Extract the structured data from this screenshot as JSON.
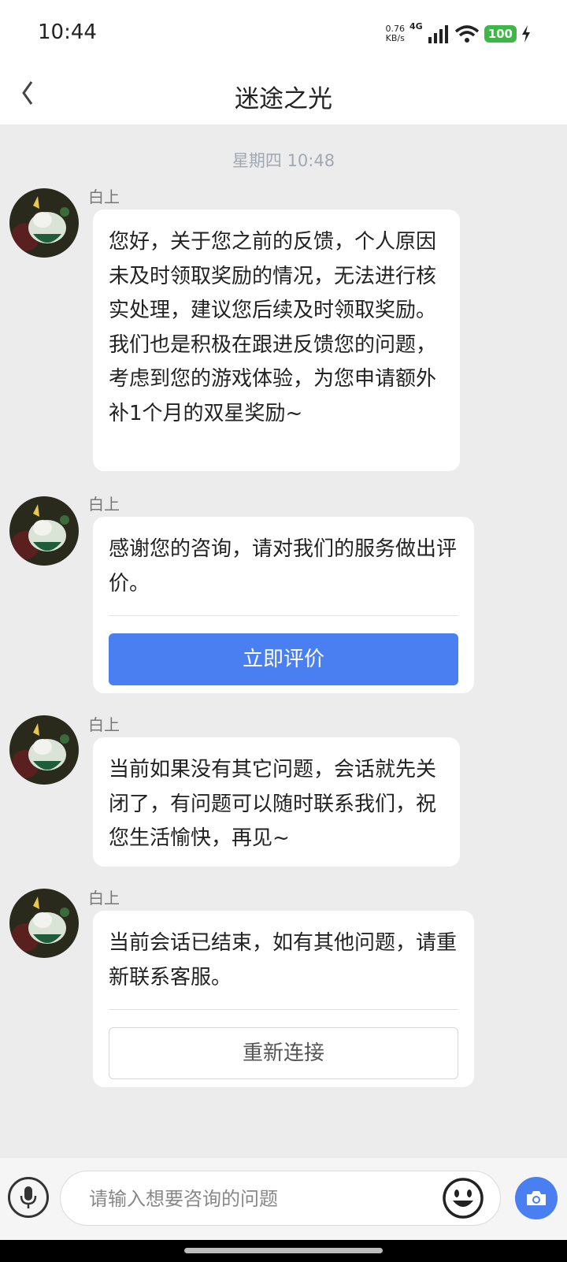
{
  "status_bar": {
    "time": "10:44",
    "speed_value": "0.76",
    "speed_unit": "KB/s",
    "network": "4G",
    "battery": "100"
  },
  "header": {
    "back_icon": "chevron-left-icon",
    "title": "迷途之光"
  },
  "chat": {
    "timestamp": "星期四 10:48",
    "messages": [
      {
        "sender": "白上",
        "paragraphs": [
          "您好，关于您之前的反馈，个人原因未及时领取奖励的情况，无法进行核实处理，建议您后续及时领取奖励。",
          "我们也是积极在跟进反馈您的问题，考虑到您的游戏体验，为您申请额外补1个月的双星奖励~"
        ]
      },
      {
        "sender": "白上",
        "paragraphs": [
          "感谢您的咨询，请对我们的服务做出评价。"
        ],
        "button": "立即评价"
      },
      {
        "sender": "白上",
        "paragraphs": [
          "当前如果没有其它问题，会话就先关闭了，有问题可以随时联系我们，祝您生活愉快，再见~"
        ]
      },
      {
        "sender": "白上",
        "paragraphs": [
          "当前会话已结束，如有其他问题，请重新联系客服。"
        ],
        "button": "重新连接"
      }
    ]
  },
  "input_bar": {
    "placeholder": "请输入想要咨询的问题",
    "icons": [
      "microphone-icon",
      "emoji-icon",
      "camera-icon"
    ]
  },
  "colors": {
    "accent": "#4a7ff2",
    "background": "#ececec",
    "battery": "#3db847"
  }
}
